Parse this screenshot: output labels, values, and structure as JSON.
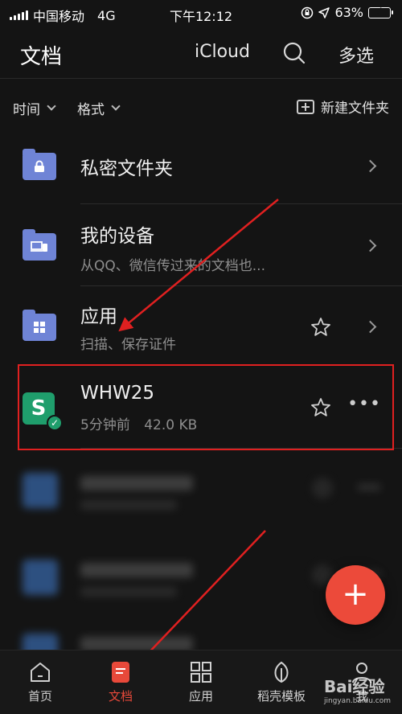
{
  "status_bar": {
    "carrier": "中国移动",
    "network": "4G",
    "time": "下午12:12",
    "battery_percent": "63%",
    "battery_level": 0.63
  },
  "header": {
    "title": "文档",
    "icloud_label": "iCloud",
    "multiselect_label": "多选"
  },
  "filters": {
    "time_label": "时间",
    "format_label": "格式",
    "new_folder_label": "新建文件夹"
  },
  "list": {
    "private_folder": {
      "title": "私密文件夹"
    },
    "my_devices": {
      "title": "我的设备",
      "subtitle": "从QQ、微信传过来的文档也..."
    },
    "apps_folder": {
      "title": "应用",
      "subtitle": "扫描、保存证件"
    },
    "document": {
      "title": "WHW25",
      "time": "5分钟前",
      "size": "42.0 KB",
      "icon_letter": "S"
    }
  },
  "fab": {
    "symbol": "+"
  },
  "tabs": [
    {
      "label": "首页",
      "icon": "home-icon"
    },
    {
      "label": "文档",
      "icon": "document-icon",
      "active": true
    },
    {
      "label": "应用",
      "icon": "apps-grid-icon"
    },
    {
      "label": "稻壳模板",
      "icon": "leaf-icon"
    },
    {
      "label": "我",
      "icon": "user-icon"
    }
  ],
  "watermark": {
    "text": "Baiéå¸ç»éª",
    "url": "jingyan.baidu.com"
  },
  "colors": {
    "accent": "#e8493a",
    "folder": "#6f84d6",
    "doc_green": "#1f9e6c",
    "annotation_red": "#e02020"
  }
}
